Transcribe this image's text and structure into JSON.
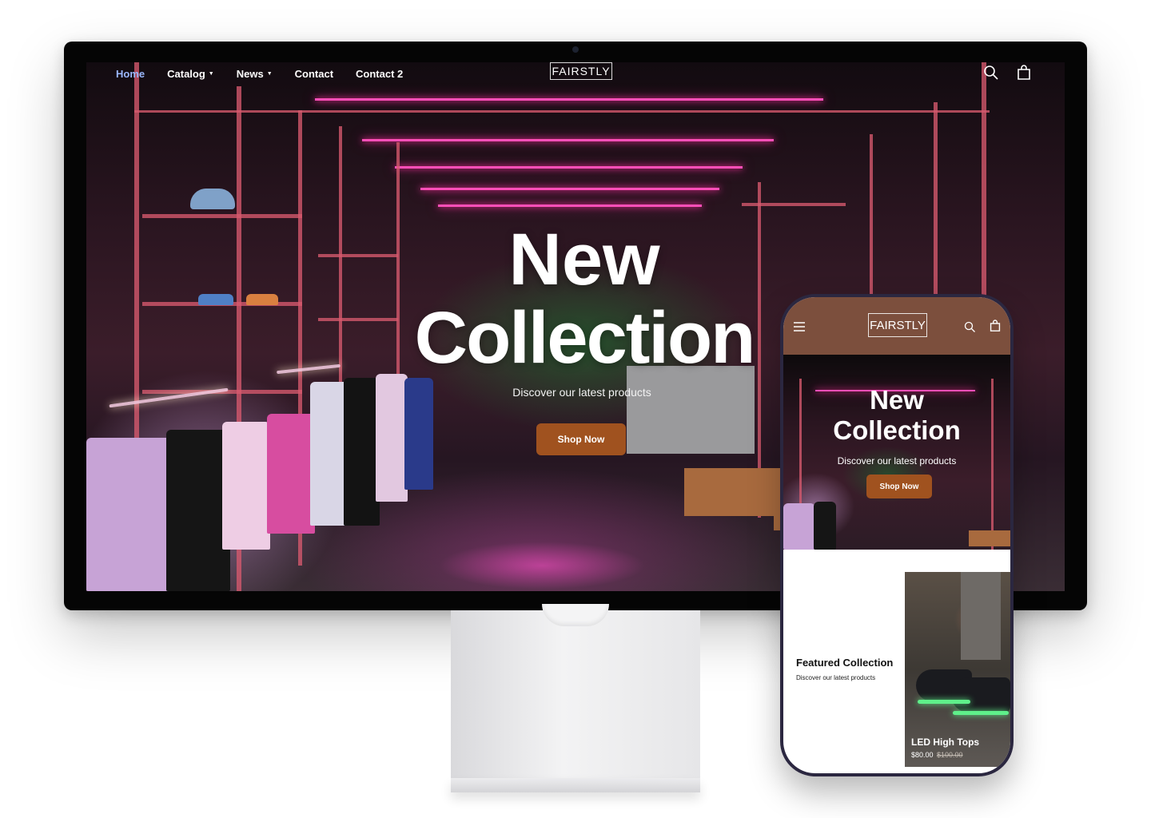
{
  "desktop": {
    "nav": {
      "items": [
        {
          "label": "Home",
          "active": true,
          "dropdown": false
        },
        {
          "label": "Catalog",
          "active": false,
          "dropdown": true
        },
        {
          "label": "News",
          "active": false,
          "dropdown": true
        },
        {
          "label": "Contact",
          "active": false,
          "dropdown": false
        },
        {
          "label": "Contact 2",
          "active": false,
          "dropdown": false
        }
      ],
      "logo": "FAIRSTLY",
      "icons": [
        "search-icon",
        "shopping-bag-icon"
      ]
    },
    "hero": {
      "title_line1": "New",
      "title_line2": "Collection",
      "subtitle": "Discover our latest products",
      "button_label": "Shop Now"
    }
  },
  "mobile": {
    "header": {
      "logo": "FAIRSTLY",
      "icons": [
        "hamburger-menu-icon",
        "search-icon",
        "shopping-bag-icon"
      ]
    },
    "hero": {
      "title_line1": "New",
      "title_line2": "Collection",
      "subtitle": "Discover our latest products",
      "button_label": "Shop Now"
    },
    "featured": {
      "title": "Featured Collection",
      "subtitle": "Discover our latest products",
      "product": {
        "name": "LED High Tops",
        "price": "$80.00",
        "compare_price": "$100.00"
      }
    }
  },
  "colors": {
    "accent_button": "#a0521f",
    "mobile_header": "#7c4f3d",
    "nav_active": "#9bb8ff",
    "neon": "#ff4fb8"
  }
}
